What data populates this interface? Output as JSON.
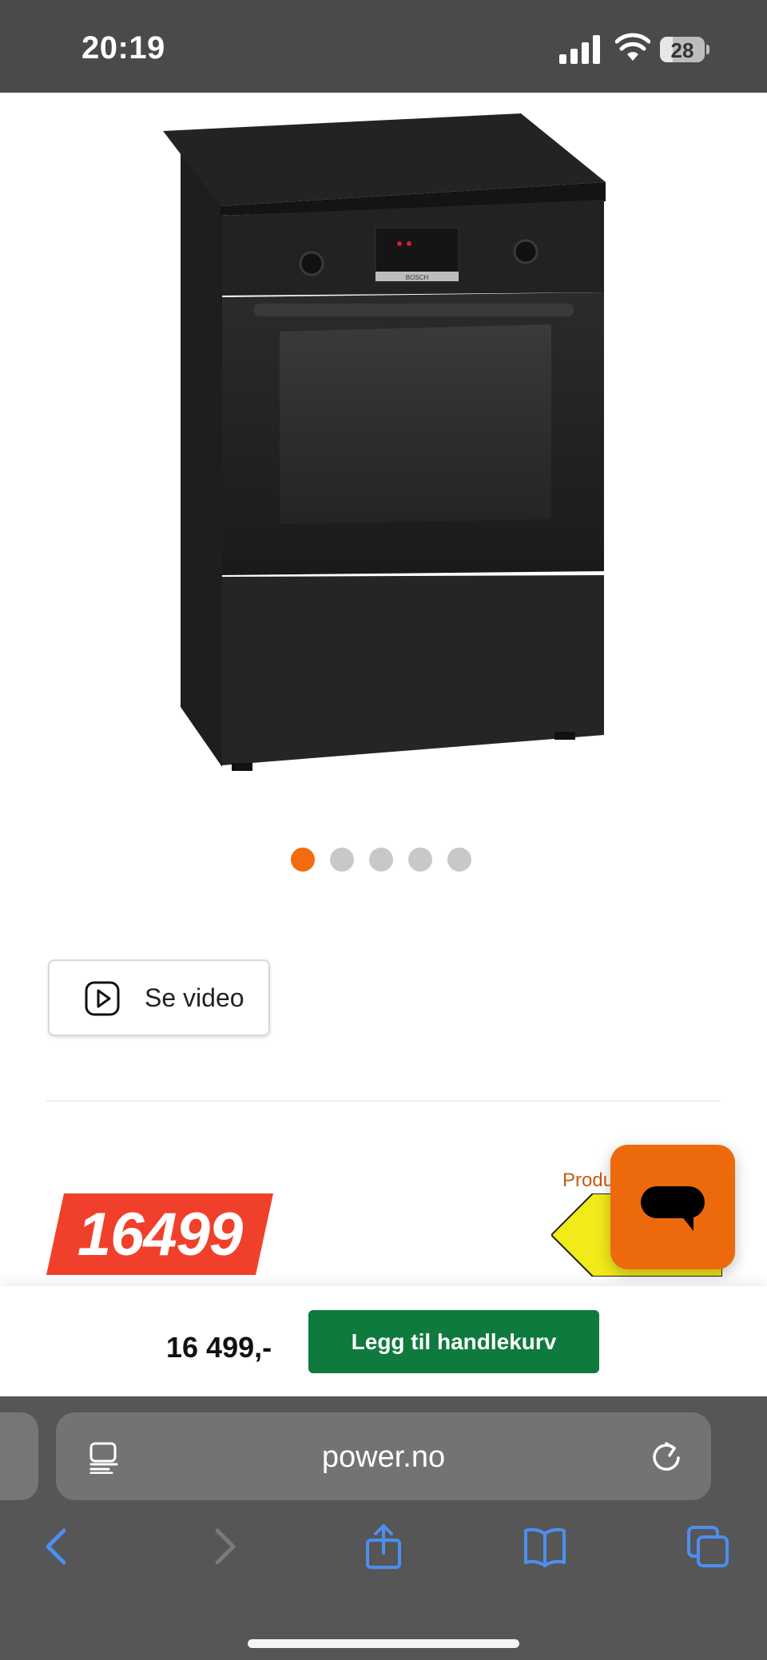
{
  "status_bar": {
    "time": "20:19",
    "battery": "28",
    "battery_level": 0.28
  },
  "product": {
    "image_icon": "bosch-black-electric-cooker-image",
    "brand_badge": "BOSCH"
  },
  "carousel": {
    "total": 5,
    "active_index": 0,
    "active_color": "#f26b0f"
  },
  "video_button": {
    "icon": "play-icon",
    "label": "Se video"
  },
  "price_badge": {
    "value": "16499",
    "color": "#f0402b"
  },
  "energy_label": {
    "text": "Produ"
  },
  "chat": {
    "icon": "chat-bubble-icon",
    "color": "#ed6a0c"
  },
  "cart_bar": {
    "price": "16 499,-",
    "add_button_label": "Legg til handlekurv",
    "button_color": "#0f7a3e"
  },
  "browser": {
    "url": "power.no",
    "reader_icon": "reader-icon",
    "reload_icon": "reload-icon",
    "accent_color": "#4b8ff0",
    "toolbar": [
      "back-icon",
      "forward-icon",
      "share-icon",
      "bookmarks-icon",
      "tabs-icon"
    ]
  }
}
